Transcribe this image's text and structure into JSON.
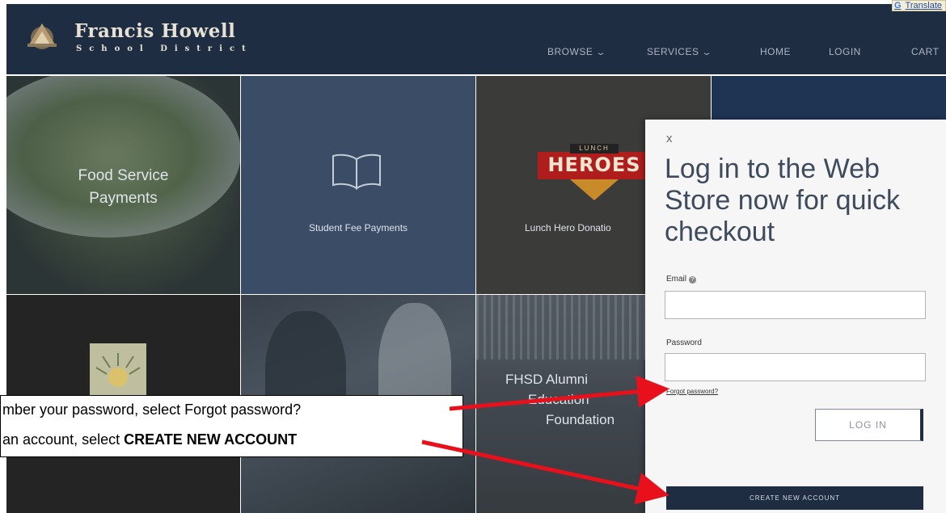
{
  "header": {
    "brand_name": "Francis Howell",
    "brand_sub": "School District",
    "translate_label": "Translate",
    "nav": [
      {
        "label": "BROWSE",
        "has_dropdown": true
      },
      {
        "label": "SERVICES",
        "has_dropdown": true
      },
      {
        "label": "HOME",
        "has_dropdown": false
      },
      {
        "label": "LOGIN",
        "has_dropdown": false
      },
      {
        "label": "CART",
        "has_dropdown": false
      }
    ]
  },
  "tiles": [
    {
      "label_line1": "Food Service",
      "label_line2": "Payments"
    },
    {
      "label": "Student Fee Payments",
      "icon": "book-icon"
    },
    {
      "label": "Lunch Hero Donatio",
      "badge_text": "HEROES",
      "badge_top": "LUNCH"
    },
    {
      "label": ""
    },
    {
      "label": ""
    },
    {
      "label": ""
    },
    {
      "label_line1": "FHSD Alumni",
      "label_line2": "Education",
      "label_line3": "Foundation"
    }
  ],
  "login": {
    "close": "x",
    "title": "Log in to the Web Store now for quick checkout",
    "email_label": "Email",
    "email_value": "",
    "password_label": "Password",
    "password_value": "",
    "forgot_label": "Forgot password?",
    "login_button": "LOG IN",
    "create_button": "CREATE NEW ACCOUNT"
  },
  "callout": {
    "line1": "mber your password, select Forgot password?",
    "line2_prefix": "an account, select ",
    "line2_bold": "CREATE NEW ACCOUNT"
  },
  "colors": {
    "header_bg": "#1f2d42",
    "arrow": "#e8101a",
    "panel_bg": "#f6f6f6"
  }
}
